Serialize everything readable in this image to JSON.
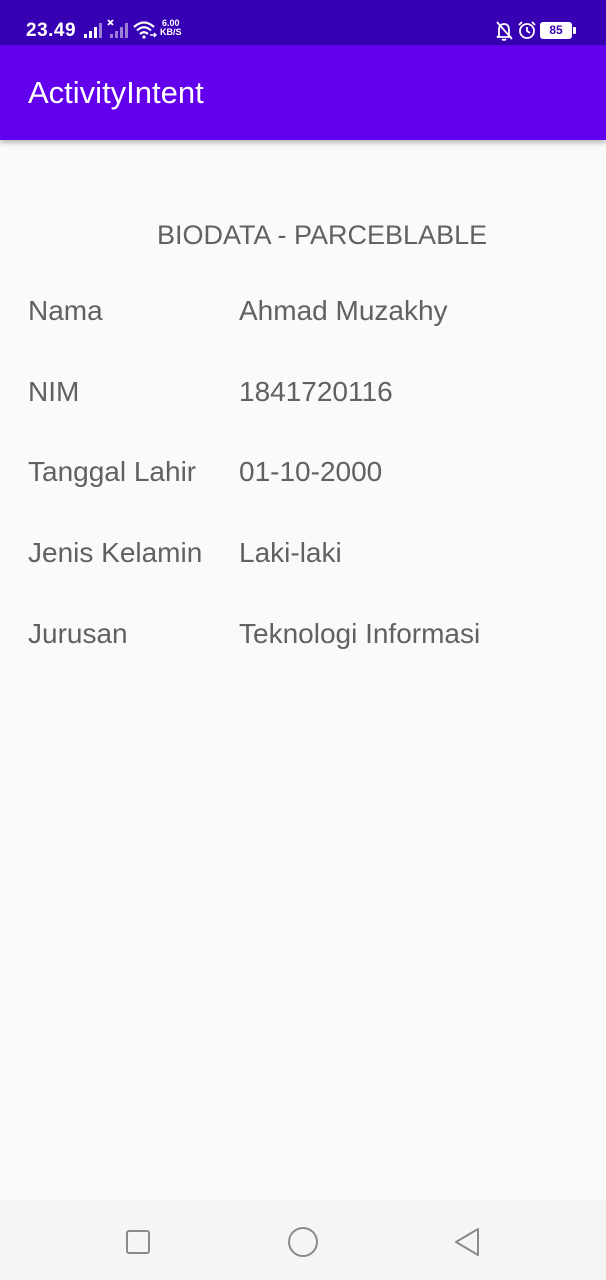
{
  "status_bar": {
    "time": "23.49",
    "net_speed_value": "6.00",
    "net_speed_unit": "KB/S",
    "battery": "85"
  },
  "app_bar": {
    "title": "ActivityIntent"
  },
  "biodata": {
    "heading": "BIODATA - PARCEBLABLE",
    "rows": [
      {
        "label": "Nama",
        "value": "Ahmad Muzakhy"
      },
      {
        "label": "NIM",
        "value": "1841720116"
      },
      {
        "label": "Tanggal Lahir",
        "value": "01-10-2000"
      },
      {
        "label": "Jenis Kelamin",
        "value": "Laki-laki"
      },
      {
        "label": "Jurusan",
        "value": "Teknologi Informasi"
      }
    ]
  },
  "icons": {
    "signal": "signal-icon",
    "no-signal": "no-signal-icon",
    "wifi": "wifi-icon",
    "silent": "bell-off-icon",
    "alarm": "alarm-icon",
    "nav_recents": "square-icon",
    "nav_home": "circle-icon",
    "nav_back": "triangle-back-icon"
  },
  "colors": {
    "status_bar": "#3700b3",
    "app_bar": "#6200ee",
    "background": "#fafafa",
    "text": "#616161"
  }
}
